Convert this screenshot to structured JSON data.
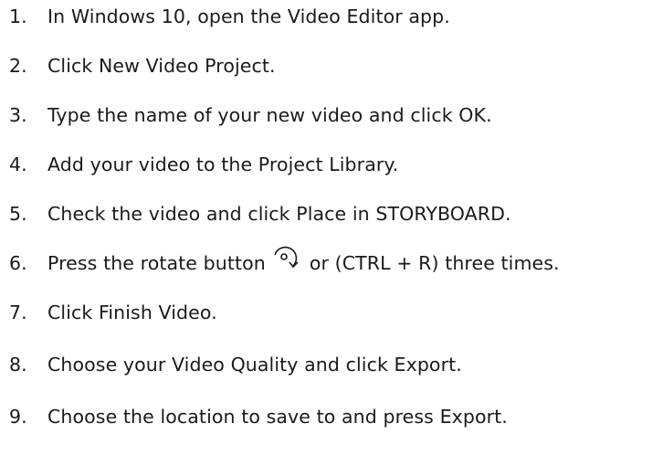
{
  "steps": [
    {
      "number": "1.",
      "text": "In Windows 10, open the Video Editor app."
    },
    {
      "number": "2.",
      "text": "Click New Video Project."
    },
    {
      "number": "3.",
      "text": "Type the name of your new video and click OK."
    },
    {
      "number": "4.",
      "text": "Add your video to the Project Library."
    },
    {
      "number": "5.",
      "text": "Check the video and click Place in STORYBOARD."
    },
    {
      "number": "6.",
      "text_before": "Press the rotate button",
      "icon": "rotate-icon",
      "text_after": "or (CTRL + R) three times."
    },
    {
      "number": "7.",
      "text": "Click Finish Video."
    },
    {
      "number": "8.",
      "text": "Choose your Video Quality and click Export."
    },
    {
      "number": "9.",
      "text": "Choose the location to save to and press Export."
    }
  ]
}
